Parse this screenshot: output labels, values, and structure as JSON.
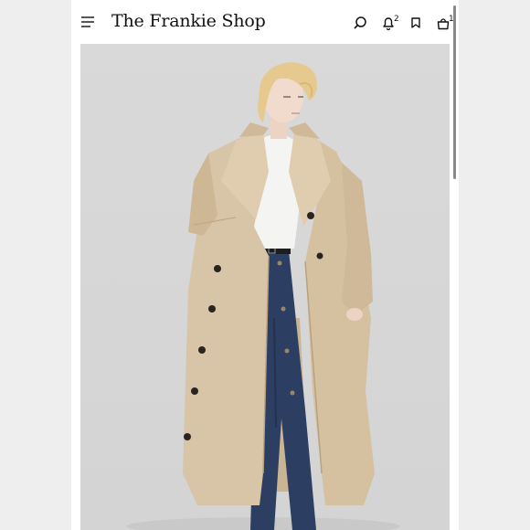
{
  "header": {
    "brand": "The Frankie Shop",
    "notifications_count": "2",
    "cart_count": "1"
  },
  "icons": [
    "hamburger-menu-icon",
    "search-icon",
    "bell-icon",
    "bookmark-icon",
    "shopping-bag-icon"
  ],
  "colors": {
    "page_background": "#eeeeee",
    "header_background": "#ffffff",
    "photo_background": "#d7d7d7",
    "coat": "#d8c4a6",
    "denim": "#2c3f63"
  }
}
